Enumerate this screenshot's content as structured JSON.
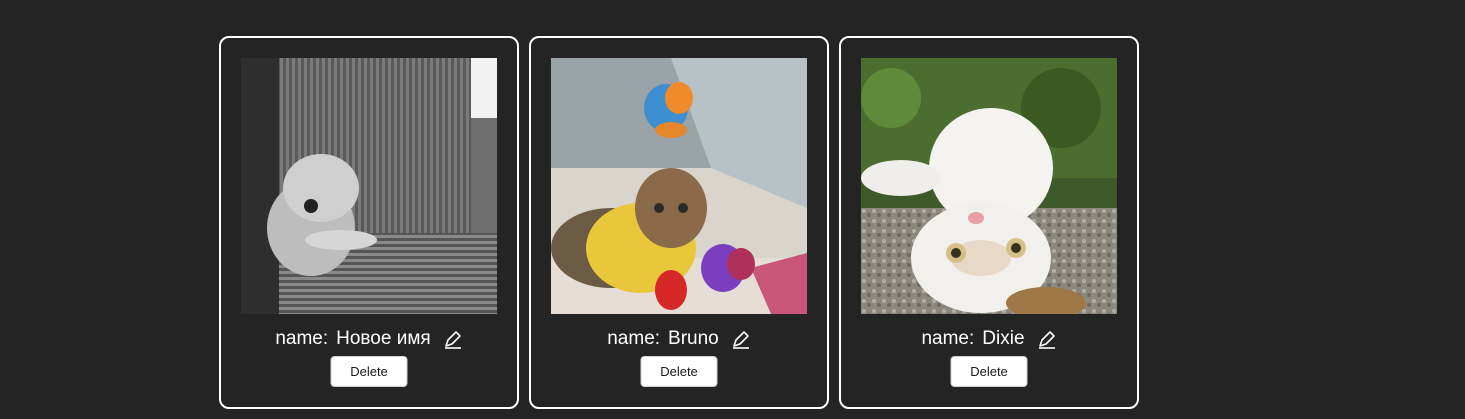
{
  "cards": [
    {
      "image_alt": "gray kitten peeking on couch",
      "name_label": "name:",
      "name_value": "Новое имя",
      "delete_label": "Delete"
    },
    {
      "image_alt": "cat in yellow outfit with toys",
      "name_label": "name:",
      "name_value": "Bruno",
      "delete_label": "Delete"
    },
    {
      "image_alt": "white cat lying upside down",
      "name_label": "name:",
      "name_value": "Dixie",
      "delete_label": "Delete"
    }
  ],
  "icons": {
    "edit": "pencil-icon"
  },
  "colors": {
    "background": "#242424",
    "card_border": "#ffffff",
    "text": "#ffffff",
    "button_bg": "#ffffff"
  }
}
